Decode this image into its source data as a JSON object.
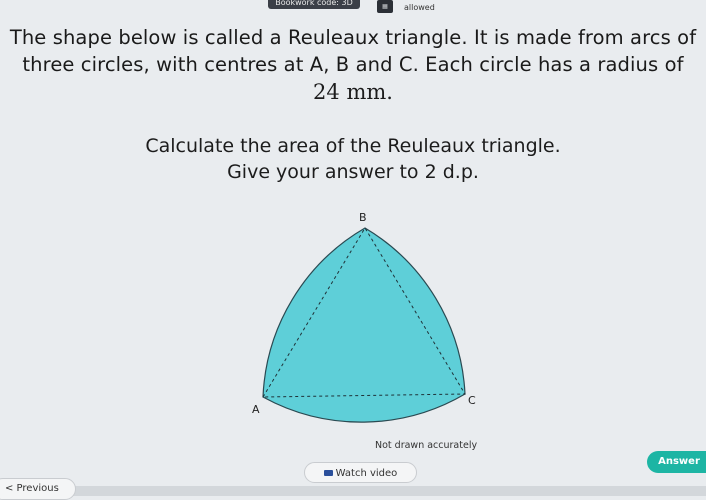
{
  "topbar": {
    "bookwork_label": "Bookwork code: 3D",
    "calculator_label": "allowed"
  },
  "question": {
    "line1": "The shape below is called a Reuleaux triangle. It is made from arcs of",
    "line2": "three circles, with centres at A, B and C. Each circle has a radius of",
    "measure": "24 mm.",
    "instruction1": "Calculate the area of the Reuleaux triangle.",
    "instruction2": "Give your answer to 2 d.p."
  },
  "figure": {
    "label_a": "A",
    "label_b": "B",
    "label_c": "C",
    "note": "Not drawn accurately",
    "fill_color": "#5ecfd8",
    "stroke_color": "#2a4a52"
  },
  "buttons": {
    "answer": "Answer",
    "watch_video": "Watch video",
    "previous": "< Previous"
  },
  "colors": {
    "accent": "#1db5a4",
    "background": "#e9ecef"
  }
}
